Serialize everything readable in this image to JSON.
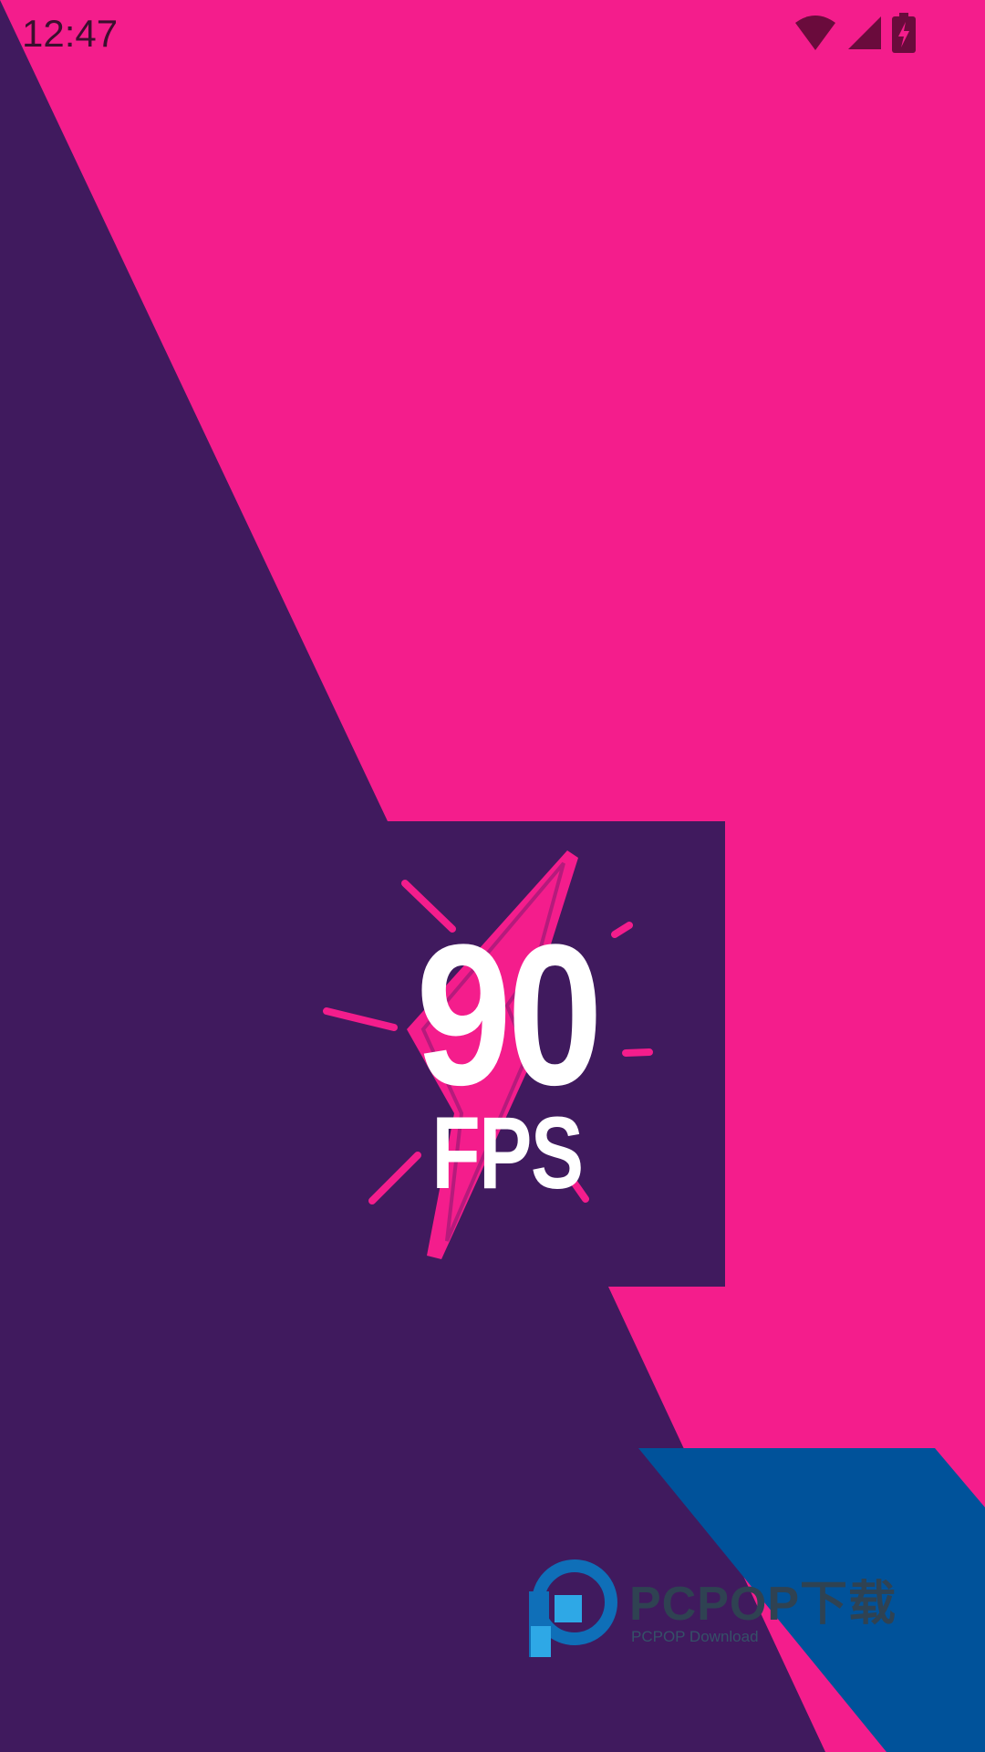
{
  "status_bar": {
    "time": "12:47",
    "icons": [
      "wifi-icon",
      "cell-signal-icon",
      "battery-charging-icon"
    ]
  },
  "splash": {
    "logo_number": "90",
    "logo_unit": "FPS",
    "logo_icon": "lightning-bolt-icon"
  },
  "watermark": {
    "brand": "PCPOP下载",
    "subtitle": "PCPOP Download",
    "icon": "pcpop-logo-icon"
  },
  "colors": {
    "pink": "#f41d8c",
    "purple": "#401a5e",
    "blue": "#00529a",
    "white": "#ffffff"
  }
}
